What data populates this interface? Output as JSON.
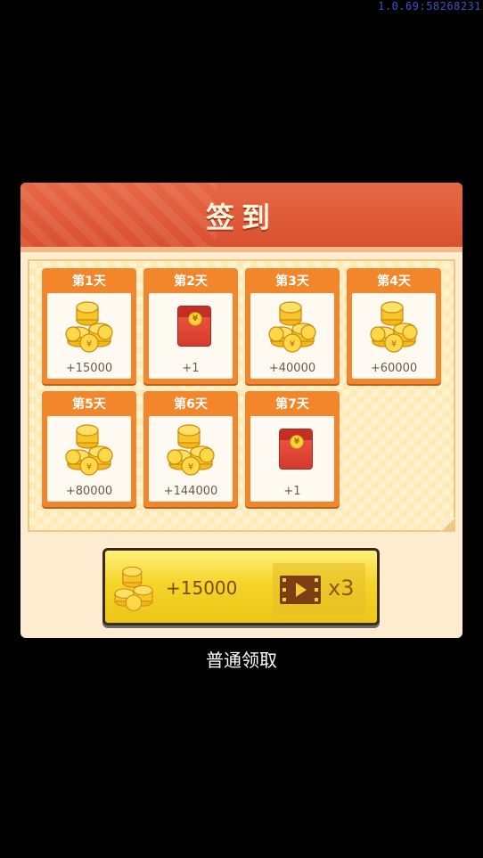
{
  "version": "1.0.69:58268231",
  "panel": {
    "title": "签到"
  },
  "days": [
    {
      "label": "第1天",
      "amount": "+15000",
      "reward": "coins"
    },
    {
      "label": "第2天",
      "amount": "+1",
      "reward": "red-packet"
    },
    {
      "label": "第3天",
      "amount": "+40000",
      "reward": "coins"
    },
    {
      "label": "第4天",
      "amount": "+60000",
      "reward": "coins"
    },
    {
      "label": "第5天",
      "amount": "+80000",
      "reward": "coins"
    },
    {
      "label": "第6天",
      "amount": "+144000",
      "reward": "coins"
    },
    {
      "label": "第7天",
      "amount": "+1",
      "reward": "red-packet"
    }
  ],
  "claim_button": {
    "amount": "+15000",
    "multiplier": "x3",
    "video_icon": "film-strip-play-icon"
  },
  "normal_claim": "普通领取",
  "colors": {
    "header": "#d9502f",
    "card": "#f3862a",
    "button": "#f5d42a"
  }
}
